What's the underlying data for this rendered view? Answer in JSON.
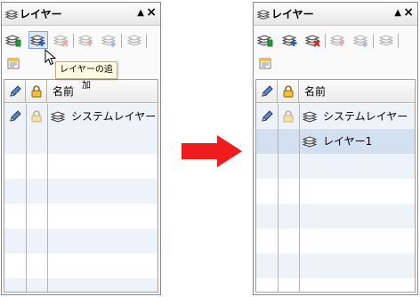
{
  "before": {
    "title": "レイヤー",
    "tooltip": "レイヤーの追加",
    "columns": {
      "name": "名前"
    },
    "layers": [
      {
        "name": "システムレイヤー"
      }
    ]
  },
  "after": {
    "title": "レイヤー",
    "columns": {
      "name": "名前"
    },
    "layers": [
      {
        "name": "システムレイヤー"
      },
      {
        "name": "レイヤー1",
        "selected": true
      }
    ]
  },
  "icons": {
    "layers": "layers-icon",
    "pin": "pin-icon",
    "close": "close-icon",
    "edit": "pencil-icon",
    "lock": "lock-icon",
    "add": "add-layer-icon",
    "delete": "delete-layer-icon",
    "arrow": "right-arrow"
  },
  "colors": {
    "arrow": "#ee1c1c",
    "selected_row": "#d2e0f2",
    "alt_row": "#eef3fa",
    "tooltip_bg": "#fffbe0"
  }
}
